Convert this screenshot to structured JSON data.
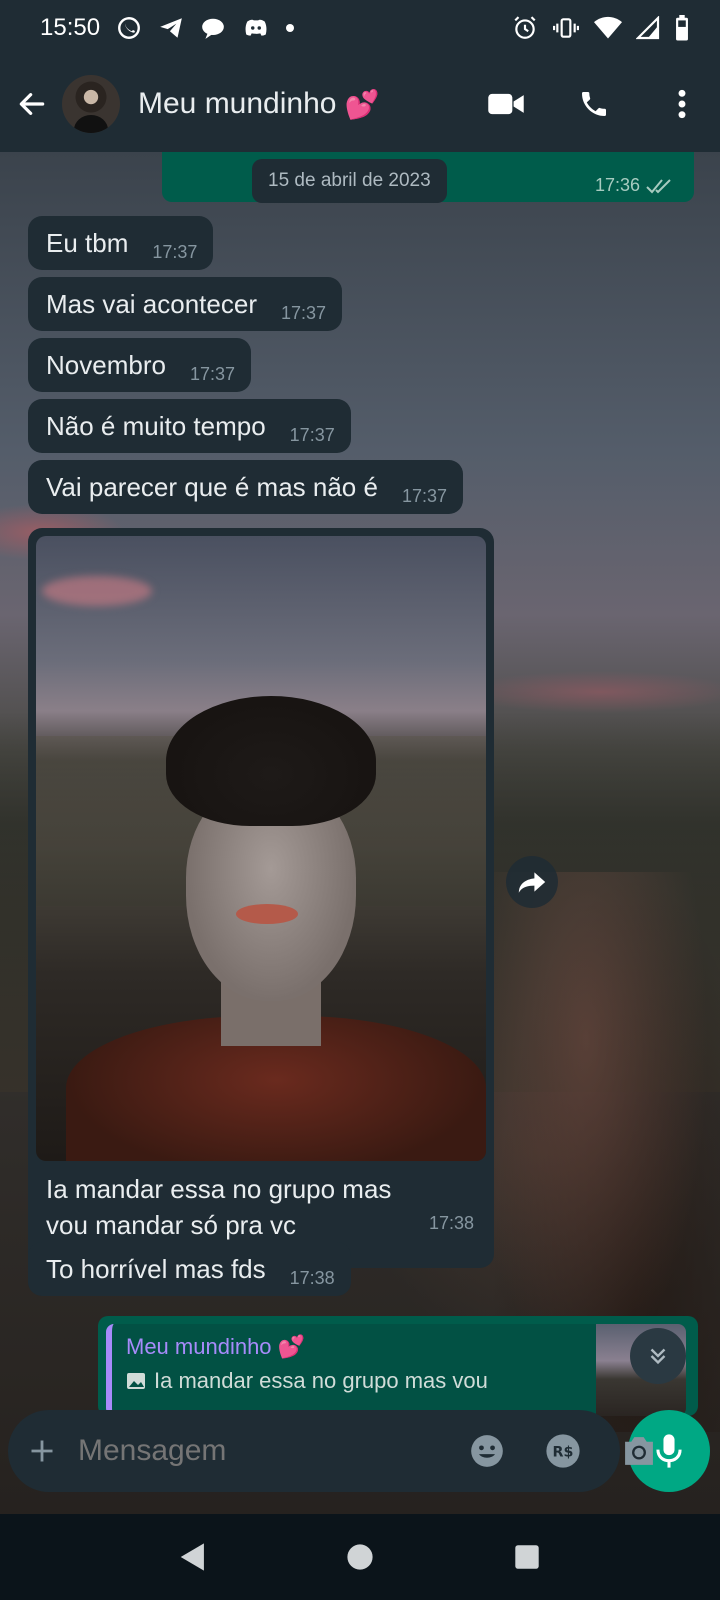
{
  "status_bar": {
    "time": "15:50",
    "icons_left": [
      "whatsapp-icon",
      "telegram-icon",
      "chat-bubble-icon",
      "discord-icon",
      "dot-icon"
    ],
    "icons_right": [
      "alarm-icon",
      "vibrate-icon",
      "wifi-icon",
      "signal-icon",
      "battery-icon"
    ]
  },
  "header": {
    "contact_name": "Meu mundinho",
    "contact_emoji": "💕",
    "actions": [
      "video-call-icon",
      "phone-icon",
      "more-vert-icon"
    ]
  },
  "chat": {
    "date_chip": "15 de abril de 2023",
    "top_outgoing_time": "17:36",
    "messages_in": [
      {
        "text": "Eu tbm",
        "time": "17:37"
      },
      {
        "text": "Mas vai acontecer",
        "time": "17:37"
      },
      {
        "text": "Novembro",
        "time": "17:37"
      },
      {
        "text": "Não é muito tempo",
        "time": "17:37"
      },
      {
        "text": "Vai parecer que é mas não é",
        "time": "17:37"
      }
    ],
    "media_message": {
      "caption_line1": "Ia mandar essa no grupo mas",
      "caption_line2": "vou mandar só pra vc",
      "time": "17:38"
    },
    "last_in": {
      "text": "To horrível mas fds",
      "time": "17:38"
    },
    "reply": {
      "author": "Meu mundinho",
      "author_emoji": "💕",
      "quoted_text": "Ia mandar essa no grupo mas vou"
    }
  },
  "composer": {
    "placeholder": "Mensagem"
  },
  "colors": {
    "header_bg": "#1f2c34",
    "outgoing_bubble": "#005c4b",
    "incoming_bubble": "#1f2c34",
    "accent": "#00a884",
    "reply_author": "#a78bfa"
  }
}
